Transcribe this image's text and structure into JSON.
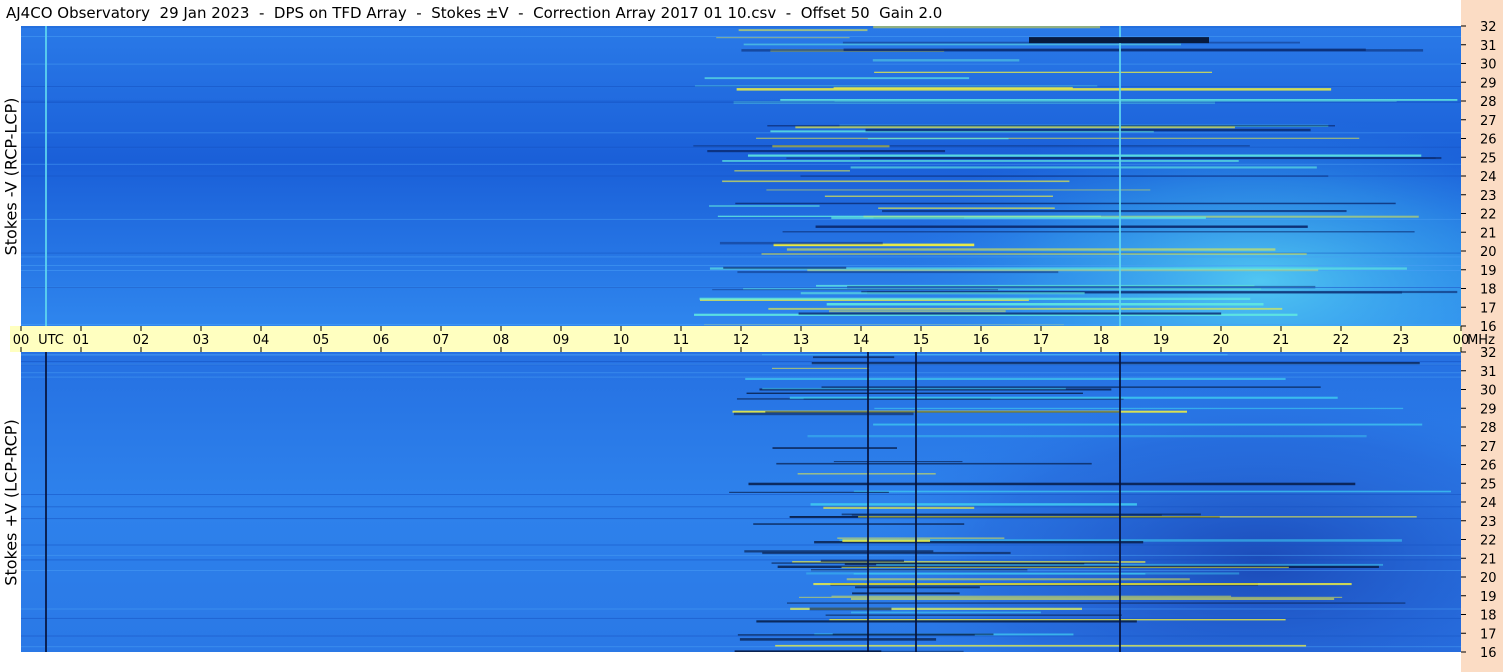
{
  "title": "AJ4CO Observatory  29 Jan 2023  -  DPS on TFD Array  -  Stokes ±V  -  Correction Array 2017 01 10.csv  -  Offset 50  Gain 2.0",
  "colors": {
    "time_axis_bg": "#ffffc0",
    "right_rail_bg": "#fbdcc4",
    "spectrogram_base": "#1f6ee0",
    "spectrogram_active": "#3ec8f0",
    "rfi_hot": "#f0f040",
    "dropout": "#061a40"
  },
  "chart_data": [
    {
      "type": "heatmap",
      "panel": "top",
      "ylabel": "Stokes -V (RCP-LCP)",
      "ylim": [
        16,
        32
      ],
      "y_ticks": [
        "16",
        "17",
        "18",
        "19",
        "20",
        "21",
        "22",
        "23",
        "24",
        "25",
        "26",
        "27",
        "28",
        "29",
        "30",
        "31",
        "32"
      ],
      "y_unit": "MHz",
      "xlim_utc_hours": [
        0,
        24
      ],
      "colormap": "blue-cyan-yellow",
      "sun_activity_start_utc": 12.8,
      "vertical_events_utc": [
        0.4,
        18.3
      ],
      "dark_burst_utc": [
        16.8,
        19.8
      ],
      "dark_burst_mhz": 31.3
    },
    {
      "type": "heatmap",
      "panel": "bottom",
      "ylabel": "Stokes +V (LCP-RCP)",
      "ylim": [
        16,
        32
      ],
      "y_ticks": [
        "16",
        "17",
        "18",
        "19",
        "20",
        "21",
        "22",
        "23",
        "24",
        "25",
        "26",
        "27",
        "28",
        "29",
        "30",
        "31",
        "32"
      ],
      "y_unit": "MHz",
      "xlim_utc_hours": [
        0,
        24
      ],
      "colormap": "blue-cyan-yellow",
      "sun_activity_start_utc": 12.8,
      "vertical_events_utc": [
        0.4,
        18.3,
        14.1,
        14.9
      ]
    }
  ],
  "time_axis": {
    "labels": [
      "00",
      "01",
      "02",
      "03",
      "04",
      "05",
      "06",
      "07",
      "08",
      "09",
      "10",
      "11",
      "12",
      "13",
      "14",
      "15",
      "16",
      "17",
      "18",
      "19",
      "20",
      "21",
      "22",
      "23",
      "00"
    ],
    "utc_label": "UTC",
    "unit_label": "MHz"
  }
}
